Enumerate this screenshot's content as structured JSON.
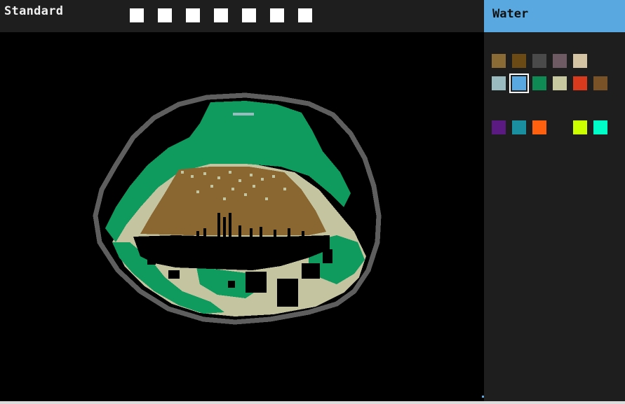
{
  "topbar": {
    "mode_label": "Standard",
    "tool_buttons": [
      "tool-1",
      "tool-2",
      "tool-3",
      "tool-4",
      "tool-5",
      "tool-6",
      "tool-7"
    ]
  },
  "panel": {
    "selected_element": "Water",
    "header_color": "#5aa8e0",
    "palette_rows": [
      [
        "#8a6a35",
        "#6b4a15",
        "#4a4a4a",
        "#6e5a62",
        "#d4c4a4"
      ],
      [
        "#9abcc0",
        "#5aa8e0",
        "#0f8a55",
        "#c8c8a0",
        "#d83a1e",
        "#7a5228"
      ],
      [
        "#5a1a82",
        "#1a8fa0",
        "#ff6010",
        "",
        "#ccff00",
        "#00ffc8"
      ]
    ],
    "selected_swatch": [
      1,
      1
    ]
  },
  "colors": {
    "background": "#000000",
    "bar": "#1e1e1e",
    "wall": "#5e5e5e",
    "grass": "#0f9a5e",
    "sand": "#c4c4a0",
    "dirt": "#8a6630",
    "water_streak": "#9abcc0"
  }
}
